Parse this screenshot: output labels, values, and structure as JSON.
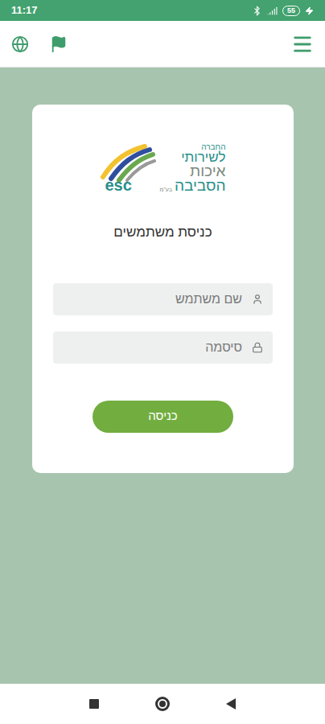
{
  "status_bar": {
    "time": "11:17",
    "battery": "55"
  },
  "logo": {
    "mark": "esc",
    "lines": [
      "החברה",
      "לשירותי",
      "איכות",
      "הסביבה"
    ],
    "suffix": "בע\"מ"
  },
  "login": {
    "title": "כניסת משתמשים",
    "fields": [
      {
        "placeholder": "שם משתמש",
        "kind": "user"
      },
      {
        "placeholder": "סיסמה",
        "kind": "password"
      }
    ],
    "button": "כניסה"
  }
}
